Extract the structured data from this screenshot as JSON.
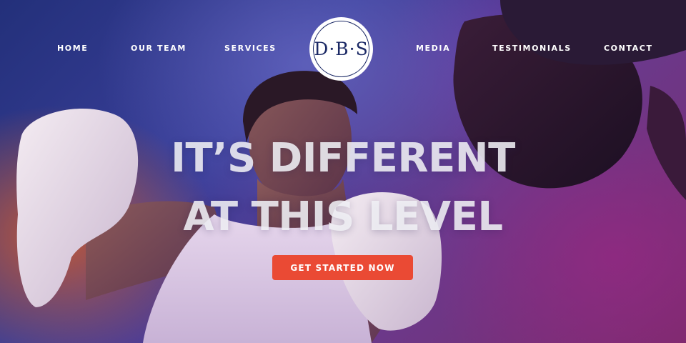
{
  "nav": {
    "items": [
      {
        "label": "HOME"
      },
      {
        "label": "OUR TEAM"
      },
      {
        "label": "SERVICES"
      },
      {
        "label": "MEDIA"
      },
      {
        "label": "TESTIMONIALS"
      },
      {
        "label": "CONTACT"
      }
    ],
    "logo_text": "D·B·S"
  },
  "hero": {
    "headline_line1": "IT’S DIFFERENT",
    "headline_line2": "AT THIS LEVEL",
    "cta_label": "GET STARTED NOW",
    "cta_color": "#ea4a34"
  }
}
